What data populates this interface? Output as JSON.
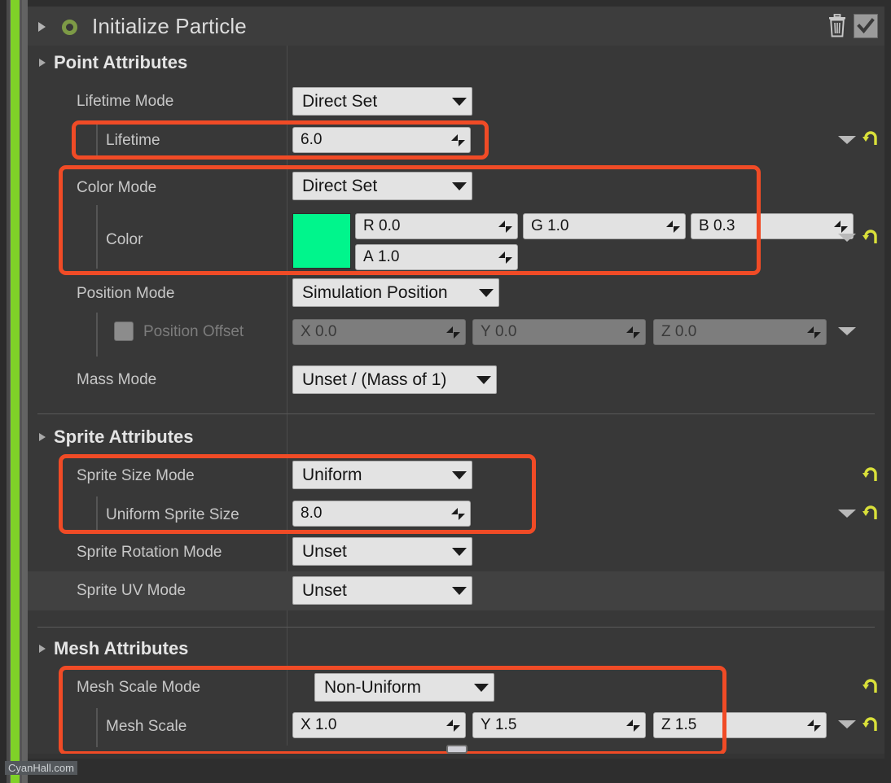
{
  "header": {
    "title": "Initialize Particle",
    "expand_icon": "triangle-right-icon",
    "module_icon": "module-enabled-circle-icon",
    "delete_icon": "trash-icon",
    "enabled_checkbox": "checkmark-icon",
    "enabled": true
  },
  "colors": {
    "accent_green": "#7fd128",
    "highlight_red": "#f04b26",
    "swatch": "#00f58c",
    "reset_yellow": "#d9e03a"
  },
  "sections": [
    {
      "name": "point_attributes",
      "title": "Point Attributes",
      "rows": [
        {
          "label": "Lifetime Mode",
          "type": "combo",
          "value": "Direct Set"
        },
        {
          "label": "Lifetime",
          "type": "number",
          "value": "6.0",
          "highlighted": true
        },
        {
          "label": "Color Mode",
          "type": "combo",
          "value": "Direct Set",
          "highlighted": true
        },
        {
          "label": "Color",
          "type": "color",
          "highlighted": true,
          "swatch": "#00f58c",
          "channels": [
            {
              "label": "R",
              "value": "0.0"
            },
            {
              "label": "G",
              "value": "1.0"
            },
            {
              "label": "B",
              "value": "0.3"
            },
            {
              "label": "A",
              "value": "1.0"
            }
          ]
        },
        {
          "label": "Position Mode",
          "type": "combo",
          "value": "Simulation Position"
        },
        {
          "label": "Position Offset",
          "type": "vector",
          "disabled": true,
          "checkbox": false,
          "axes": [
            {
              "label": "X",
              "value": "0.0"
            },
            {
              "label": "Y",
              "value": "0.0"
            },
            {
              "label": "Z",
              "value": "0.0"
            }
          ]
        },
        {
          "label": "Mass Mode",
          "type": "combo",
          "value": "Unset / (Mass of 1)"
        }
      ]
    },
    {
      "name": "sprite_attributes",
      "title": "Sprite Attributes",
      "rows": [
        {
          "label": "Sprite Size Mode",
          "type": "combo",
          "value": "Uniform",
          "highlighted": true
        },
        {
          "label": "Uniform Sprite Size",
          "type": "number",
          "value": "8.0",
          "highlighted": true
        },
        {
          "label": "Sprite Rotation Mode",
          "type": "combo",
          "value": "Unset"
        },
        {
          "label": "Sprite UV Mode",
          "type": "combo",
          "value": "Unset"
        }
      ]
    },
    {
      "name": "mesh_attributes",
      "title": "Mesh Attributes",
      "rows": [
        {
          "label": "Mesh Scale Mode",
          "type": "combo",
          "value": "Non-Uniform",
          "highlighted": true
        },
        {
          "label": "Mesh Scale",
          "type": "vector",
          "highlighted": true,
          "axes": [
            {
              "label": "X",
              "value": "1.0"
            },
            {
              "label": "Y",
              "value": "1.5"
            },
            {
              "label": "Z",
              "value": "1.5"
            }
          ]
        }
      ]
    }
  ],
  "watermark": "CyanHall.com",
  "icons": {
    "reset": "reset-arrow-icon",
    "expand": "expand-arrow-icon",
    "drag": "drag-handle-icon"
  }
}
